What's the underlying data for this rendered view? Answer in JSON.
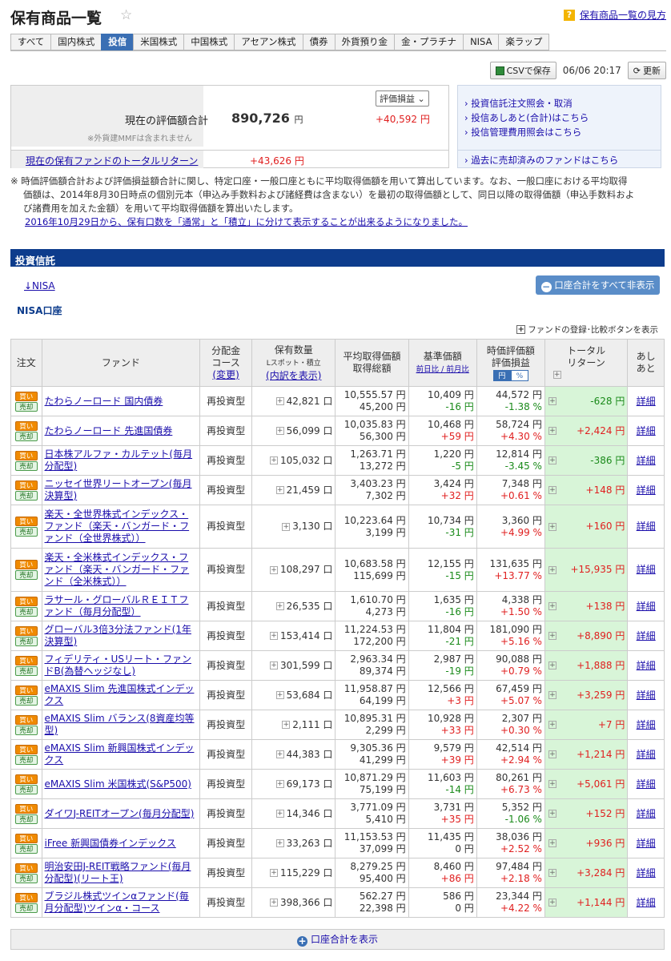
{
  "header": {
    "title": "保有商品一覧",
    "help_link": "保有商品一覧の見方"
  },
  "tabs": [
    "すべて",
    "国内株式",
    "投信",
    "米国株式",
    "中国株式",
    "アセアン株式",
    "債券",
    "外貨預り金",
    "金・プラチナ",
    "NISA",
    "楽ラップ"
  ],
  "active_tab": "投信",
  "toolbar": {
    "csv_label": "CSVで保存",
    "timestamp": "06/06 20:17",
    "refresh_label": "更新"
  },
  "summary": {
    "label": "現在の評価額合計",
    "note": "※外貨建MMFは含まれません",
    "value": "890,726",
    "unit": "円",
    "select": "評価損益",
    "gain": "+40,592 円",
    "return_label": "現在の保有ファンドのトータルリターン",
    "return_value": "+43,626 円"
  },
  "side_links": [
    "投資信託注文照会・取消",
    "投信あしあと(合計)はこちら",
    "投信管理費用照会はこちら",
    "過去に売却済みのファンドはこちら"
  ],
  "notes": {
    "line1": "※ 時価評価額合計および評価損益額合計に関し、特定口座・一般口座ともに平均取得価額を用いて算出しています。なお、一般口座における平均取得",
    "line2": "価額は、2014年8月30日時点の個別元本（申込み手数料および諸経費は含まない）を最初の取得価額として、同日以降の取得価額（申込手数料およ",
    "line3": "び諸費用を加えた金額）を用いて平均取得価額を算出いたします。",
    "link": "2016年10月29日から、保有口数を「通常」と「積立」に分けて表示することが出来るようになりました。"
  },
  "section": {
    "title": "投資信託",
    "nisa_link": "↓NISA",
    "hide_btn": "口座合計をすべて非表示",
    "account": "NISA口座",
    "register": "ファンドの登録･比較ボタンを表示"
  },
  "columns": {
    "order": "注文",
    "fund": "ファンド",
    "course1": "分配金",
    "course2": "コース",
    "course3": "(変更)",
    "qty1": "保有数量",
    "qty2": "Lスポット・積立",
    "qty3": "(内訳を表示)",
    "avg1": "平均取得価額",
    "avg2": "取得総額",
    "base1": "基準価額",
    "base2": "前日比 / 前月比",
    "eval1": "時価評価額",
    "eval2": "評価損益",
    "yen": "円",
    "pct": "%",
    "ret1": "トータル",
    "ret2": "リターン",
    "foot1": "あし",
    "foot2": "あと"
  },
  "buy_label": "買い",
  "sell_label": "売却",
  "detail_label": "詳細",
  "funds": [
    {
      "name": "たわらノーロード 国内債券",
      "course": "再投資型",
      "qty": "42,821 口",
      "avg": "10,555.57 円",
      "cost": "45,200 円",
      "base": "10,409 円",
      "diff": "-16 円",
      "val": "44,572 円",
      "pl": "-1.38 %",
      "ret": "-628 円"
    },
    {
      "name": "たわらノーロード 先進国債券",
      "course": "再投資型",
      "qty": "56,099 口",
      "avg": "10,035.83 円",
      "cost": "56,300 円",
      "base": "10,468 円",
      "diff": "+59 円",
      "val": "58,724 円",
      "pl": "+4.30 %",
      "ret": "+2,424 円"
    },
    {
      "name": "日本株アルファ・カルテット(毎月分配型)",
      "course": "再投資型",
      "qty": "105,032 口",
      "avg": "1,263.71 円",
      "cost": "13,272 円",
      "base": "1,220 円",
      "diff": "-5 円",
      "val": "12,814 円",
      "pl": "-3.45 %",
      "ret": "-386 円"
    },
    {
      "name": "ニッセイ世界リートオープン(毎月決算型)",
      "course": "再投資型",
      "qty": "21,459 口",
      "avg": "3,403.23 円",
      "cost": "7,302 円",
      "base": "3,424 円",
      "diff": "+32 円",
      "val": "7,348 円",
      "pl": "+0.61 %",
      "ret": "+148 円"
    },
    {
      "name": "楽天・全世界株式インデックス・ファンド（楽天・バンガード・ファンド（全世界株式））",
      "course": "再投資型",
      "qty": "3,130 口",
      "avg": "10,223.64 円",
      "cost": "3,199 円",
      "base": "10,734 円",
      "diff": "-31 円",
      "val": "3,360 円",
      "pl": "+4.99 %",
      "ret": "+160 円"
    },
    {
      "name": "楽天・全米株式インデックス・ファンド（楽天・バンガード・ファンド（全米株式））",
      "course": "再投資型",
      "qty": "108,297 口",
      "avg": "10,683.58 円",
      "cost": "115,699 円",
      "base": "12,155 円",
      "diff": "-15 円",
      "val": "131,635 円",
      "pl": "+13.77 %",
      "ret": "+15,935 円"
    },
    {
      "name": "ラサール・グローバルＲＥＩＴファンド（毎月分配型）",
      "course": "再投資型",
      "qty": "26,535 口",
      "avg": "1,610.70 円",
      "cost": "4,273 円",
      "base": "1,635 円",
      "diff": "-16 円",
      "val": "4,338 円",
      "pl": "+1.50 %",
      "ret": "+138 円"
    },
    {
      "name": "グローバル3倍3分法ファンド(1年決算型)",
      "course": "再投資型",
      "qty": "153,414 口",
      "avg": "11,224.53 円",
      "cost": "172,200 円",
      "base": "11,804 円",
      "diff": "-21 円",
      "val": "181,090 円",
      "pl": "+5.16 %",
      "ret": "+8,890 円"
    },
    {
      "name": "フィデリティ・USリート・ファンドB(為替ヘッジなし)",
      "course": "再投資型",
      "qty": "301,599 口",
      "avg": "2,963.34 円",
      "cost": "89,374 円",
      "base": "2,987 円",
      "diff": "-19 円",
      "val": "90,088 円",
      "pl": "+0.79 %",
      "ret": "+1,888 円"
    },
    {
      "name": "eMAXIS Slim 先進国株式インデックス",
      "course": "再投資型",
      "qty": "53,684 口",
      "avg": "11,958.87 円",
      "cost": "64,199 円",
      "base": "12,566 円",
      "diff": "+3 円",
      "val": "67,459 円",
      "pl": "+5.07 %",
      "ret": "+3,259 円"
    },
    {
      "name": "eMAXIS Slim バランス(8資産均等型)",
      "course": "再投資型",
      "qty": "2,111 口",
      "avg": "10,895.31 円",
      "cost": "2,299 円",
      "base": "10,928 円",
      "diff": "+33 円",
      "val": "2,307 円",
      "pl": "+0.30 %",
      "ret": "+7 円"
    },
    {
      "name": "eMAXIS Slim 新興国株式インデックス",
      "course": "再投資型",
      "qty": "44,383 口",
      "avg": "9,305.36 円",
      "cost": "41,299 円",
      "base": "9,579 円",
      "diff": "+39 円",
      "val": "42,514 円",
      "pl": "+2.94 %",
      "ret": "+1,214 円"
    },
    {
      "name": "eMAXIS Slim 米国株式(S&P500)",
      "course": "再投資型",
      "qty": "69,173 口",
      "avg": "10,871.29 円",
      "cost": "75,199 円",
      "base": "11,603 円",
      "diff": "-14 円",
      "val": "80,261 円",
      "pl": "+6.73 %",
      "ret": "+5,061 円"
    },
    {
      "name": "ダイワJ-REITオープン(毎月分配型)",
      "course": "再投資型",
      "qty": "14,346 口",
      "avg": "3,771.09 円",
      "cost": "5,410 円",
      "base": "3,731 円",
      "diff": "+35 円",
      "val": "5,352 円",
      "pl": "-1.06 %",
      "ret": "+152 円"
    },
    {
      "name": "iFree 新興国債券インデックス",
      "course": "再投資型",
      "qty": "33,263 口",
      "avg": "11,153.53 円",
      "cost": "37,099 円",
      "base": "11,435 円",
      "diff": "0 円",
      "val": "38,036 円",
      "pl": "+2.52 %",
      "ret": "+936 円"
    },
    {
      "name": "明治安田J-REIT戦略ファンド(毎月分配型)(リート王)",
      "course": "再投資型",
      "qty": "115,229 口",
      "avg": "8,279.25 円",
      "cost": "95,400 円",
      "base": "8,460 円",
      "diff": "+86 円",
      "val": "97,484 円",
      "pl": "+2.18 %",
      "ret": "+3,284 円"
    },
    {
      "name": "ブラジル株式ツインαファンド(毎月分配型)ツインα・コース",
      "course": "再投資型",
      "qty": "398,366 口",
      "avg": "562.27 円",
      "cost": "22,398 円",
      "base": "586 円",
      "diff": "0 円",
      "val": "23,344 円",
      "pl": "+4.22 %",
      "ret": "+1,144 円"
    }
  ],
  "bottom_btn": "口座合計を表示"
}
